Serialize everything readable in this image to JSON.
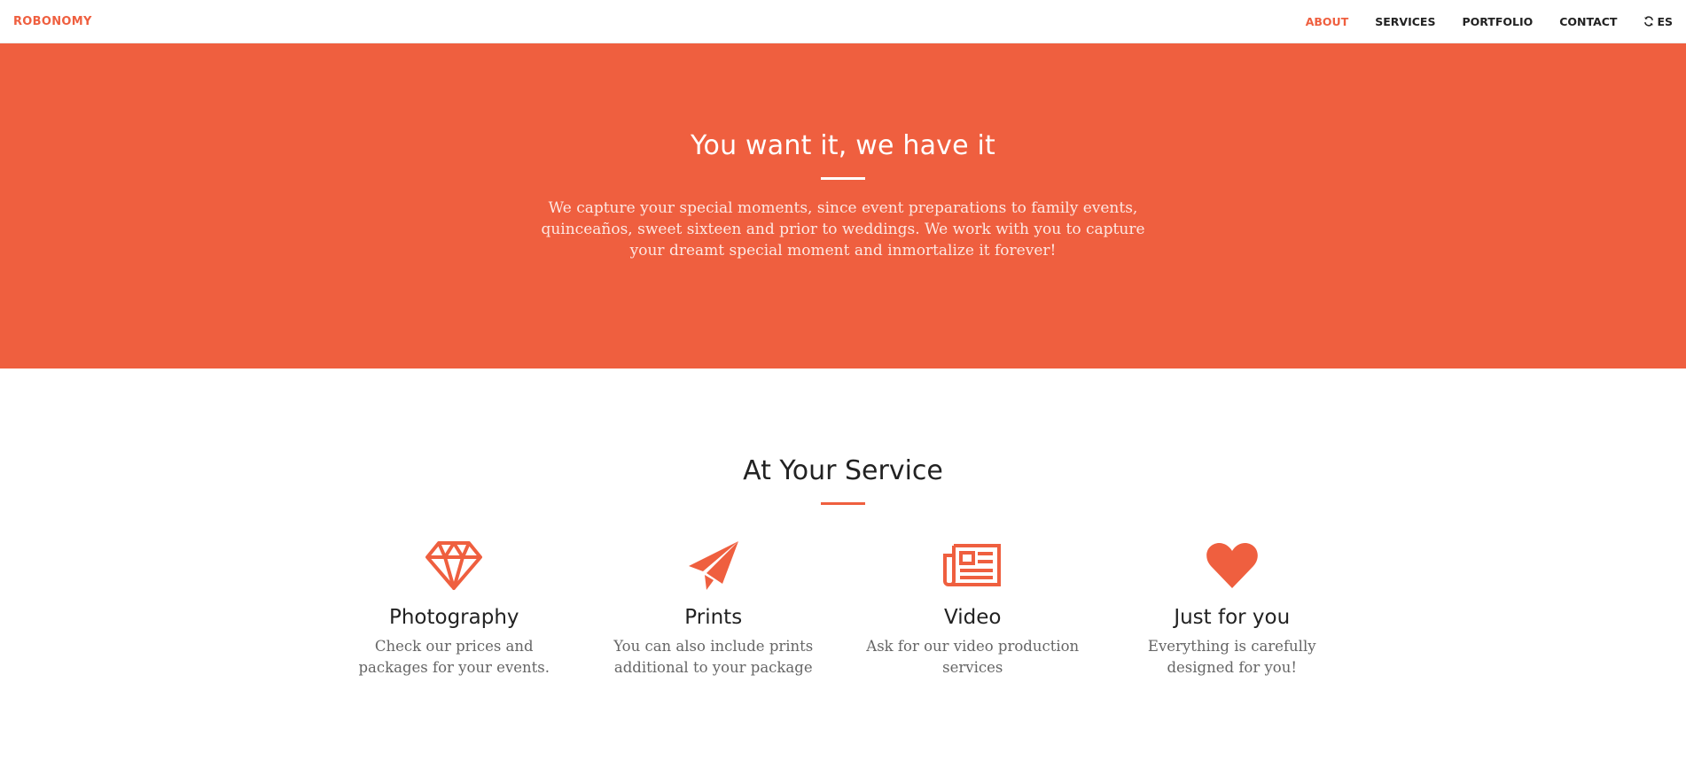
{
  "brand": "ROBONOMY",
  "colors": {
    "accent": "#ef5f3f",
    "text": "#222222",
    "muted": "#666666"
  },
  "nav": {
    "items": [
      {
        "label": "ABOUT",
        "active": true
      },
      {
        "label": "SERVICES",
        "active": false
      },
      {
        "label": "PORTFOLIO",
        "active": false
      },
      {
        "label": "CONTACT",
        "active": false
      }
    ],
    "language": {
      "icon": "refresh-icon",
      "label": "ES"
    }
  },
  "hero": {
    "title": "You want it, we have it",
    "text": "We capture your special moments, since event preparations to family events, quinceaños, sweet sixteen and prior to weddings. We work with you to capture your dreamt special moment and inmortalize it forever!"
  },
  "services": {
    "title": "At Your Service",
    "items": [
      {
        "icon": "diamond-icon",
        "title": "Photography",
        "text": "Check our prices and packages for your events."
      },
      {
        "icon": "paper-plane-icon",
        "title": "Prints",
        "text": "You can also include prints additional to your package"
      },
      {
        "icon": "newspaper-icon",
        "title": "Video",
        "text": "Ask for our video production services"
      },
      {
        "icon": "heart-icon",
        "title": "Just for you",
        "text": "Everything is carefully designed for you!"
      }
    ]
  }
}
